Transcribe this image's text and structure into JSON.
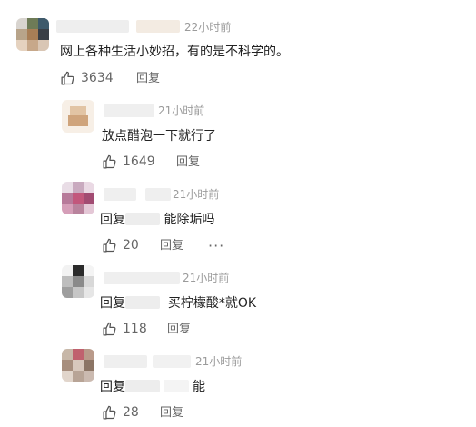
{
  "main_comment": {
    "time": "22小时前",
    "text": "网上各种生活小妙招，有的是不科学的。",
    "likes": "3634",
    "reply_label": "回复"
  },
  "replies": [
    {
      "time": "21小时前",
      "text": "放点醋泡一下就行了",
      "likes": "1649",
      "reply_label": "回复"
    },
    {
      "time": "21小时前",
      "prefix": "回复",
      "text": "能除垢吗",
      "likes": "20",
      "reply_label": "回复",
      "more": "···"
    },
    {
      "time": "21小时前",
      "prefix": "回复",
      "text": "买柠檬酸*就OK",
      "likes": "118",
      "reply_label": "回复"
    },
    {
      "time": "21小时前",
      "prefix": "回复",
      "text": "能",
      "likes": "28",
      "reply_label": "回复"
    }
  ],
  "icons": {
    "like": "thumbs-up-icon",
    "more": "more-icon"
  }
}
